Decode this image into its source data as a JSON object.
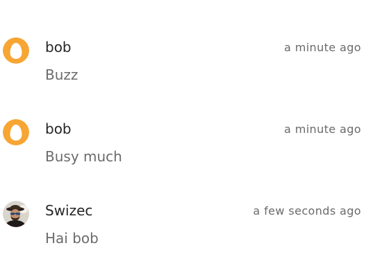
{
  "messages": [
    {
      "author": "bob",
      "time": "a minute ago",
      "text": "Buzz",
      "avatar": "egg-icon",
      "avatar_color": "#F7A533"
    },
    {
      "author": "bob",
      "time": "a minute ago",
      "text": "Busy much",
      "avatar": "egg-icon",
      "avatar_color": "#F7A533"
    },
    {
      "author": "Swizec",
      "time": "a few seconds ago",
      "text": "Hai bob",
      "avatar": "photo"
    }
  ]
}
